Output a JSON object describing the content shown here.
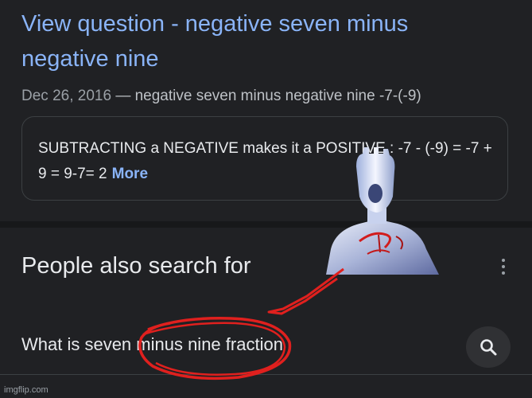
{
  "result": {
    "title": "View question - negative seven minus negative nine",
    "date": "Dec 26, 2016",
    "meta_separator": "—",
    "description": "negative seven minus negative nine -7-(-9)",
    "snippet": "SUBTRACTING a NEGATIVE makes it a POSITIVE : -7 - (-9) = -7 + 9 = 9-7= 2",
    "more_label": "More"
  },
  "people_also_search": {
    "title": "People also search for",
    "menu_icon": "more-vert-icon",
    "suggestions": [
      {
        "label": "What is seven minus nine fraction",
        "icon": "search-icon"
      }
    ]
  },
  "watermark": "imgflip.com",
  "colors": {
    "background": "#202124",
    "link": "#8ab4f8",
    "text": "#e8eaed",
    "muted": "#9aa0a6",
    "annotation": "#e0201e"
  }
}
